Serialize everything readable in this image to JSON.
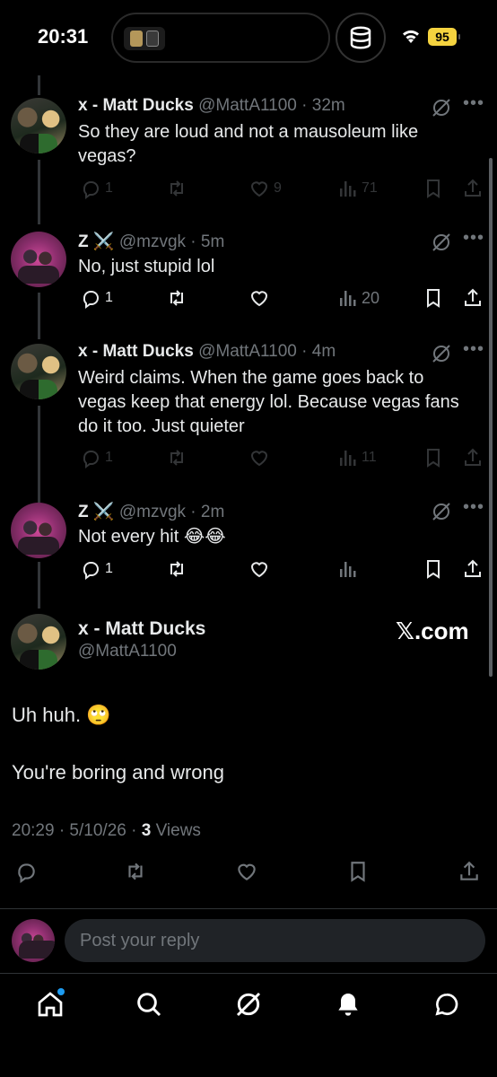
{
  "status_bar": {
    "time": "20:31",
    "battery": "95",
    "battery_color": "#f5d33f"
  },
  "tweets": [
    {
      "name": "x - Matt Ducks",
      "handle": "@MattA1100",
      "age": "32m",
      "text": "So they are loud and not a mausoleum like vegas?",
      "replies": "1",
      "reposts": "",
      "likes": "9",
      "views": "71"
    },
    {
      "name": "Z ⚔️",
      "handle": "@mzvgk",
      "age": "5m",
      "text": "No, just stupid lol",
      "replies": "1",
      "reposts": "",
      "likes": "",
      "views": "20"
    },
    {
      "name": "x - Matt Ducks",
      "handle": "@MattA1100",
      "age": "4m",
      "text": "Weird claims. When the game goes back to vegas keep that energy lol. Because vegas fans do it too. Just quieter",
      "replies": "1",
      "reposts": "",
      "likes": "",
      "views": "11"
    },
    {
      "name": "Z ⚔️",
      "handle": "@mzvgk",
      "age": "2m",
      "text": "Not every hit 😂😂",
      "replies": "1",
      "reposts": "",
      "likes": "",
      "views": ""
    }
  ],
  "main_tweet": {
    "name": "x - Matt Ducks",
    "handle": "@MattA1100",
    "watermark": "𝕏.com",
    "line1": "Uh huh. 🙄",
    "line2": "You're boring and wrong",
    "time": "20:29 · 5/10/26 · ",
    "views_count": "3",
    "views_label": " Views"
  },
  "reply": {
    "placeholder": "Post your reply"
  },
  "icons": {
    "reply": "reply-icon",
    "repost": "repost-icon",
    "like": "heart-icon",
    "views": "views-icon",
    "bookmark": "bookmark-icon",
    "share": "share-icon",
    "grok": "grok-icon",
    "nav": [
      "home-icon",
      "search-icon",
      "grok-icon",
      "notifications-icon",
      "messages-icon"
    ]
  },
  "colors": {
    "background": "#000000",
    "text": "#e7e9ea",
    "muted": "#71767b",
    "accent": "#1d9bf0"
  }
}
